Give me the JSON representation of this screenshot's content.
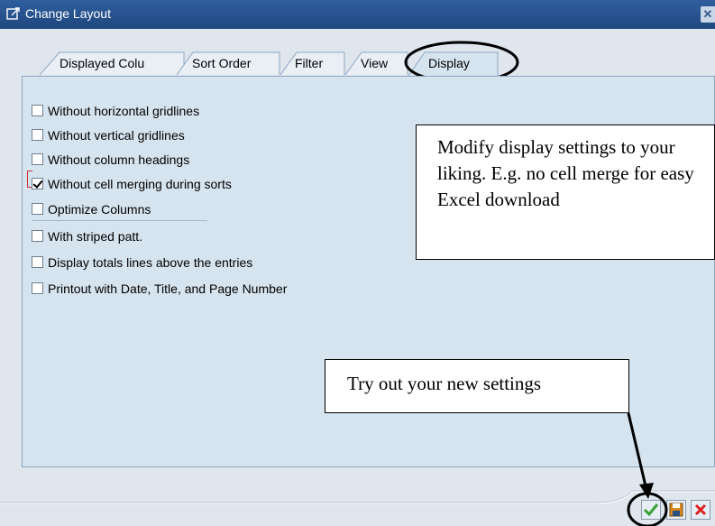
{
  "window": {
    "title": "Change Layout"
  },
  "tabs": [
    {
      "label": "Displayed Colu",
      "active": false
    },
    {
      "label": "Sort Order",
      "active": false
    },
    {
      "label": "Filter",
      "active": false
    },
    {
      "label": "View",
      "active": false
    },
    {
      "label": "Display",
      "active": true
    }
  ],
  "options": [
    {
      "label": "Without horizontal gridlines",
      "checked": false
    },
    {
      "label": "Without vertical gridlines",
      "checked": false
    },
    {
      "label": "Without column headings",
      "checked": false
    },
    {
      "label": "Without cell merging during sorts",
      "checked": true
    },
    {
      "label": "Optimize Columns",
      "checked": false
    },
    {
      "label": "With striped patt.",
      "checked": false
    },
    {
      "label": "Display totals lines above the entries",
      "checked": false
    },
    {
      "label": "Printout with Date, Title, and Page Number",
      "checked": false
    }
  ],
  "annotations": {
    "display_tip": "Modify display settings to your liking. E.g. no cell merge for easy Excel download",
    "try_tip": "Try out your new settings"
  },
  "footer": {
    "buttons": [
      "continue",
      "save",
      "cancel"
    ]
  },
  "colors": {
    "title_bar": "#2a5591",
    "panel": "#d6e4ef",
    "accent_highlight": "#000000",
    "ok_green": "#3aa335",
    "cancel_red": "#d22"
  }
}
